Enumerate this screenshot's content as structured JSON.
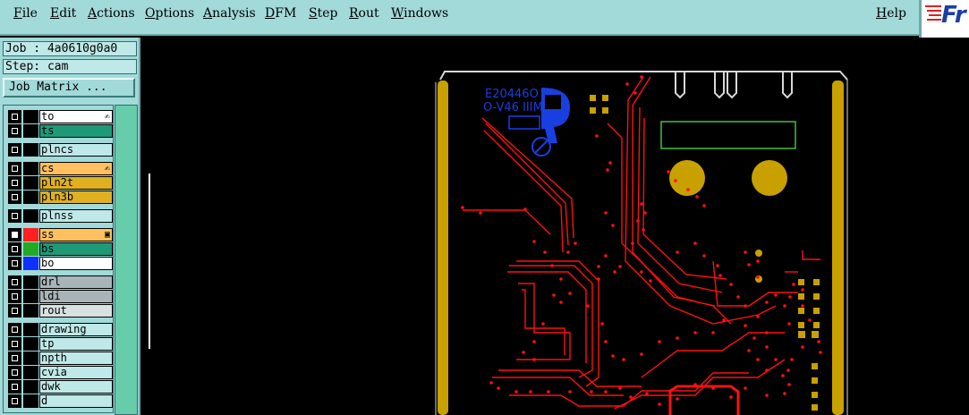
{
  "menubar": {
    "items": [
      {
        "ul": "F",
        "rest": "ile"
      },
      {
        "ul": "E",
        "rest": "dit"
      },
      {
        "ul": "A",
        "rest": "ctions"
      },
      {
        "ul": "O",
        "rest": "ptions"
      },
      {
        "ul": "A",
        "rest": "nalysis"
      },
      {
        "ul": "D",
        "rest": "FM"
      },
      {
        "ul": "S",
        "rest": "tep"
      },
      {
        "ul": "R",
        "rest": "out"
      },
      {
        "ul": "W",
        "rest": "indows"
      }
    ],
    "help": {
      "ul": "H",
      "rest": "elp"
    }
  },
  "logo": {
    "text": "Fr"
  },
  "info": {
    "job": "Job : 4a0610g0a0",
    "step": "Step: cam"
  },
  "job_matrix_label": "Job Matrix ...",
  "layers": [
    {
      "name": "to",
      "color": "#ffffff",
      "mark": "✍",
      "checked": false
    },
    {
      "name": "ts",
      "color": "#1f9a78",
      "checked": false
    },
    {
      "name": "plncs",
      "color": "#bfe8e8",
      "checked": false
    },
    {
      "name": "cs",
      "color": "#ffc060",
      "mark": "✍",
      "checked": false
    },
    {
      "name": "pln2t",
      "color": "#e0b020",
      "checked": false
    },
    {
      "name": "pln3b",
      "color": "#e0b020",
      "checked": false
    },
    {
      "name": "plnss",
      "color": "#bfe8e8",
      "checked": false
    },
    {
      "name": "ss",
      "color": "#ffc060",
      "swatch": "#ff2020",
      "mark": "▣",
      "checked": true
    },
    {
      "name": "bs",
      "color": "#1f9a78",
      "swatch": "#22aa22",
      "checked": false
    },
    {
      "name": "bo",
      "color": "#ffffff",
      "swatch": "#1030ff",
      "checked": false
    },
    {
      "name": "drl",
      "color": "#a8b4b8",
      "checked": false
    },
    {
      "name": "ldi",
      "color": "#a8b4b8",
      "checked": false
    },
    {
      "name": "rout",
      "color": "#d8e0e0",
      "checked": false
    },
    {
      "name": "drawing",
      "color": "#bfe8e8",
      "checked": false
    },
    {
      "name": "tp",
      "color": "#bfe8e8",
      "checked": false
    },
    {
      "name": "npth",
      "color": "#bfe8e8",
      "checked": false
    },
    {
      "name": "cvia",
      "color": "#bfe8e8",
      "checked": false
    },
    {
      "name": "dwk",
      "color": "#bfe8e8",
      "checked": false
    },
    {
      "name": "d",
      "color": "#bfe8e8",
      "checked": false
    }
  ],
  "board": {
    "silk_text_line1": "E20446O",
    "silk_text_line2": "O-V46 IIIM",
    "colors": {
      "trace": "#ff1010",
      "pad": "#c8a000",
      "silk": "#1a3fe0",
      "outline": "#d8d8d8",
      "component": "#40c040"
    }
  }
}
